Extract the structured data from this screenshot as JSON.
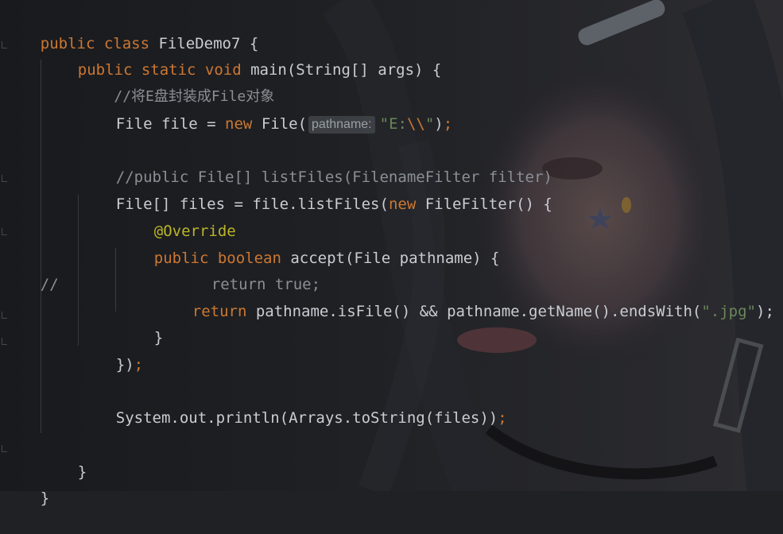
{
  "editor": {
    "lines": [
      {
        "t1": "public class",
        "t2": " FileDemo7 {"
      },
      {
        "t1": "public static void",
        "t2": " main(String[] args) {"
      },
      {
        "cm": "//将E盘封装成File对象"
      },
      {
        "t1": "File file = ",
        "kw": "new",
        "t2": " File(",
        "hint": "pathname:",
        "str1": "\"E:",
        "esc": "\\\\",
        "str2": "\"",
        "t3": ")",
        ";": ";"
      },
      {
        "cm": "//public File[] listFiles(FilenameFilter filter)"
      },
      {
        "t1": "File[] files = file.listFiles(",
        "kw": "new",
        "t2": " FileFilter() {"
      },
      {
        "ann": "@Override"
      },
      {
        "kw": "public boolean",
        "t2": " accept(File pathname) {"
      },
      {
        "cm1": "//",
        "cm2": "return true;"
      },
      {
        "kw": "return",
        "t2": " pathname.isFile() && pathname.getName().endsWith(",
        "str": "\".jpg\"",
        "t3": ");"
      },
      {
        "t1": "}"
      },
      {
        "t1": "})",
        "semi": ";"
      },
      {
        "t1": "System.out.println(Arrays.toString(files))",
        "semi": ";"
      },
      {
        "t1": "}"
      },
      {
        "t1": "}"
      }
    ]
  },
  "colors": {
    "keyword": "#cc7832",
    "string": "#6a8759",
    "comment": "#8a8f96",
    "annotation": "#bbb529",
    "text": "#c9cdd3",
    "background": "#1f2124"
  }
}
